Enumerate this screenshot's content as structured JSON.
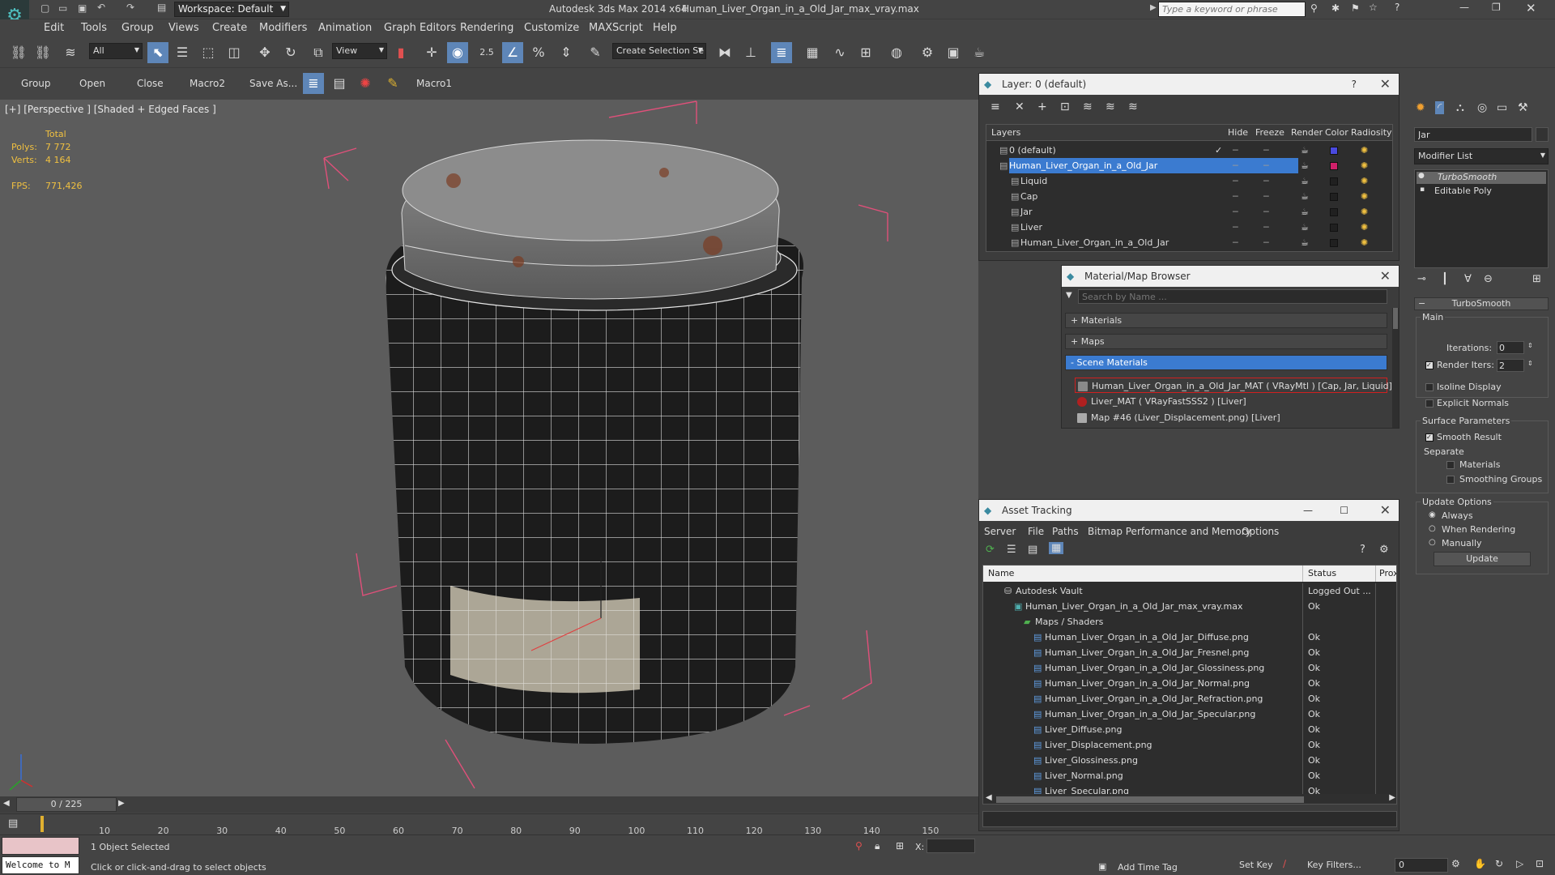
{
  "titlebar": {
    "workspace": "Workspace: Default",
    "app_title": "Autodesk 3ds Max  2014 x64",
    "file_title": "Human_Liver_Organ_in_a_Old_Jar_max_vray.max",
    "search_placeholder": "Type a keyword or phrase"
  },
  "menu": [
    "Edit",
    "Tools",
    "Group",
    "Views",
    "Create",
    "Modifiers",
    "Animation",
    "Graph Editors",
    "Rendering",
    "Customize",
    "MAXScript",
    "Help"
  ],
  "toolbar": {
    "filter_value": "All",
    "view_value": "View",
    "snap_value": "2.5",
    "selection_set_placeholder": "Create Selection Se"
  },
  "toolbar2": {
    "group": "Group",
    "open": "Open",
    "close": "Close",
    "macro2": "Macro2",
    "save_as": "Save As...",
    "macro1": "Macro1"
  },
  "viewport": {
    "label": "[+] [Perspective ] [Shaded + Edged Faces ]",
    "total_label": "Total",
    "polys_label": "Polys:",
    "polys_value": "7 772",
    "verts_label": "Verts:",
    "verts_value": "4 164",
    "fps_label": "FPS:",
    "fps_value": "771,426"
  },
  "layer_panel": {
    "title": "Layer: 0 (default)",
    "help": "?",
    "columns": [
      "Layers",
      "Hide",
      "Freeze",
      "Render",
      "Color",
      "Radiosity"
    ],
    "rows": [
      {
        "name": "0 (default)",
        "color": "#4a4adf",
        "indent": 0,
        "selected": false
      },
      {
        "name": "Human_Liver_Organ_in_a_Old_Jar",
        "color": "#d0206a",
        "indent": 0,
        "selected": true
      },
      {
        "name": "Liquid",
        "color": "#202020",
        "indent": 1,
        "selected": false
      },
      {
        "name": "Cap",
        "color": "#202020",
        "indent": 1,
        "selected": false
      },
      {
        "name": "Jar",
        "color": "#202020",
        "indent": 1,
        "selected": false
      },
      {
        "name": "Liver",
        "color": "#202020",
        "indent": 1,
        "selected": false
      },
      {
        "name": "Human_Liver_Organ_in_a_Old_Jar",
        "color": "#202020",
        "indent": 1,
        "selected": false
      }
    ]
  },
  "material_browser": {
    "title": "Material/Map Browser",
    "search_placeholder": "Search by Name ...",
    "sections": [
      "+ Materials",
      "+ Maps",
      "- Scene Materials"
    ],
    "items": [
      {
        "label": "Human_Liver_Organ_in_a_Old_Jar_MAT  ( VRayMtl )  [Cap, Jar, Liquid]",
        "swatch": "#8a8a8a"
      },
      {
        "label": "Liver_MAT  ( VRayFastSSS2 )  [Liver]",
        "swatch": "#b02020"
      },
      {
        "label": "Map #46 (Liver_Displacement.png)  [Liver]",
        "swatch": "#aaaaaa"
      }
    ]
  },
  "asset_tracking": {
    "title": "Asset Tracking",
    "menu": [
      "Server",
      "File",
      "Paths",
      "Bitmap Performance and Memory",
      "Options"
    ],
    "columns": [
      "Name",
      "Status",
      "Proxy"
    ],
    "rows": [
      {
        "name": "Autodesk Vault",
        "status": "Logged Out ...",
        "indent": 1,
        "kind": "vault"
      },
      {
        "name": "Human_Liver_Organ_in_a_Old_Jar_max_vray.max",
        "status": "Ok",
        "indent": 2,
        "kind": "max"
      },
      {
        "name": "Maps / Shaders",
        "status": "",
        "indent": 3,
        "kind": "folder"
      },
      {
        "name": "Human_Liver_Organ_in_a_Old_Jar_Diffuse.png",
        "status": "Ok",
        "indent": 4,
        "kind": "file"
      },
      {
        "name": "Human_Liver_Organ_in_a_Old_Jar_Fresnel.png",
        "status": "Ok",
        "indent": 4,
        "kind": "file"
      },
      {
        "name": "Human_Liver_Organ_in_a_Old_Jar_Glossiness.png",
        "status": "Ok",
        "indent": 4,
        "kind": "file"
      },
      {
        "name": "Human_Liver_Organ_in_a_Old_Jar_Normal.png",
        "status": "Ok",
        "indent": 4,
        "kind": "file"
      },
      {
        "name": "Human_Liver_Organ_in_a_Old_Jar_Refraction.png",
        "status": "Ok",
        "indent": 4,
        "kind": "file"
      },
      {
        "name": "Human_Liver_Organ_in_a_Old_Jar_Specular.png",
        "status": "Ok",
        "indent": 4,
        "kind": "file"
      },
      {
        "name": "Liver_Diffuse.png",
        "status": "Ok",
        "indent": 4,
        "kind": "file"
      },
      {
        "name": "Liver_Displacement.png",
        "status": "Ok",
        "indent": 4,
        "kind": "file"
      },
      {
        "name": "Liver_Glossiness.png",
        "status": "Ok",
        "indent": 4,
        "kind": "file"
      },
      {
        "name": "Liver_Normal.png",
        "status": "Ok",
        "indent": 4,
        "kind": "file"
      },
      {
        "name": "Liver_Specular.png",
        "status": "Ok",
        "indent": 4,
        "kind": "file"
      }
    ]
  },
  "command_panel": {
    "object_name": "Jar",
    "modifier_list": "Modifier List",
    "stack": [
      "TurboSmooth",
      "Editable Poly"
    ],
    "rollout_title": "TurboSmooth",
    "main_label": "Main",
    "iterations_label": "Iterations:",
    "iterations_value": "0",
    "render_iters_label": "Render Iters:",
    "render_iters_value": "2",
    "isoline_label": "Isoline Display",
    "explicit_normals_label": "Explicit Normals",
    "surface_params_label": "Surface Parameters",
    "smooth_result_label": "Smooth Result",
    "separate_label": "Separate",
    "materials_label": "Materials",
    "smoothing_groups_label": "Smoothing Groups",
    "update_options_label": "Update Options",
    "always_label": "Always",
    "when_rendering_label": "When Rendering",
    "manually_label": "Manually",
    "update_button": "Update"
  },
  "timeline": {
    "frame": "0 / 225",
    "ticks": [
      "10",
      "20",
      "30",
      "40",
      "50",
      "60",
      "70",
      "80",
      "90",
      "100",
      "110",
      "120",
      "130",
      "140",
      "150"
    ]
  },
  "status": {
    "welcome": "Welcome to M",
    "selection": "1 Object Selected",
    "prompt": "Click or click-and-drag to select objects",
    "x_label": "X:",
    "add_time_tag": "Add Time Tag",
    "set_key": "Set Key",
    "key_filters": "Key Filters...",
    "frame_value": "0"
  },
  "colors": {
    "accent": "#5e86b8",
    "selection": "#3b7bd0",
    "stat_yellow": "#f0c040",
    "bbox_pink": "#e0507a"
  }
}
